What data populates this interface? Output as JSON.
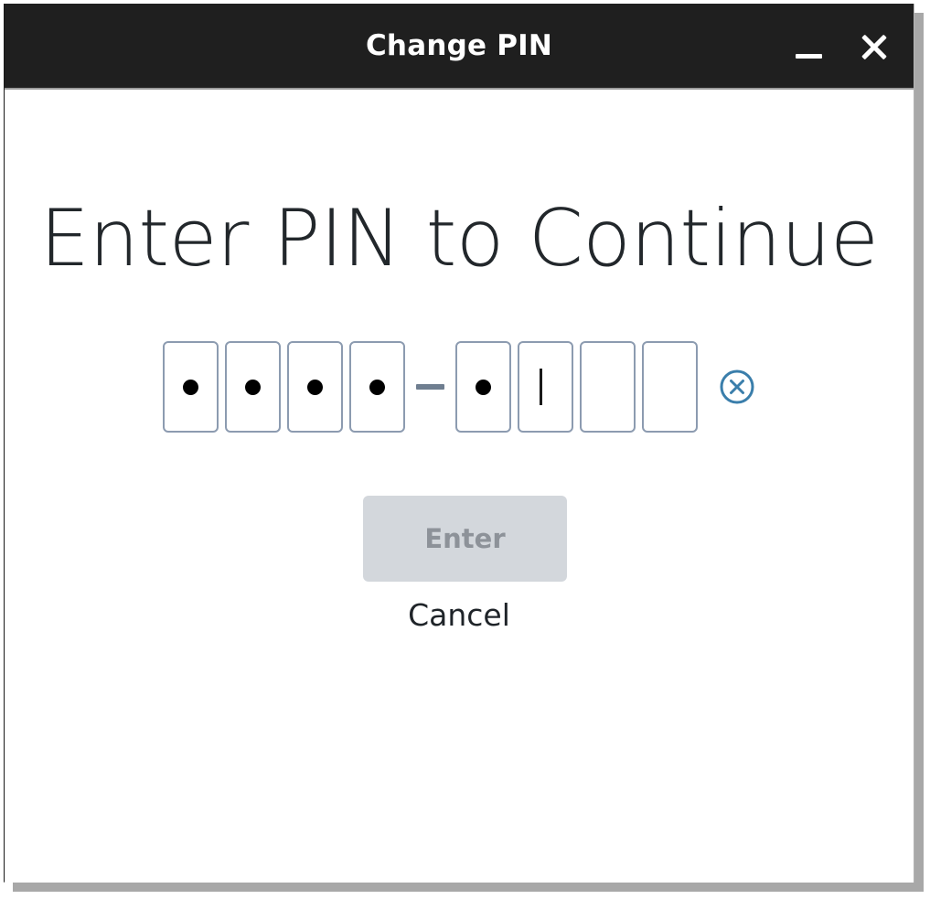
{
  "window": {
    "title": "Change PIN",
    "controls": [
      {
        "name": "minimize",
        "glyph": "minimize-icon",
        "label": "_"
      },
      {
        "name": "close",
        "glyph": "close-icon",
        "label": "X"
      }
    ]
  },
  "dialog": {
    "heading": "Enter PIN to Continue",
    "pin_entry": {
      "separator": "–",
      "cells": [
        {
          "index": 1,
          "state": "filled",
          "glyph": "•"
        },
        {
          "index": 2,
          "state": "filled",
          "glyph": "•"
        },
        {
          "index": 3,
          "state": "filled",
          "glyph": "•"
        },
        {
          "index": 4,
          "state": "filled",
          "glyph": "•"
        },
        {
          "index": 5,
          "state": "filled",
          "glyph": "•"
        },
        {
          "index": 6,
          "state": "focused",
          "glyph": ""
        },
        {
          "index": 7,
          "state": "empty",
          "glyph": ""
        },
        {
          "index": 8,
          "state": "empty",
          "glyph": ""
        }
      ],
      "filled_count": 5,
      "total_count": 8,
      "clear_icon": "clear-circle-x-icon"
    },
    "enter_button": {
      "label": "Enter",
      "state": "disabled"
    },
    "cancel_button": {
      "label": "Cancel"
    }
  },
  "colors": {
    "titlebar_bg": "#1f1f1f",
    "titlebar_text": "#ffffff",
    "content_bg": "#ffffff",
    "heading_text": "#22272b",
    "pin_border": "#8c9bb0",
    "pin_dot": "#000000",
    "clear_icon": "#3a7eab",
    "enter_bg_disabled": "#d3d7dc",
    "enter_text_disabled": "#8d9299",
    "cancel_text": "#1f2429",
    "window_shadow": "#a8a8a8"
  }
}
